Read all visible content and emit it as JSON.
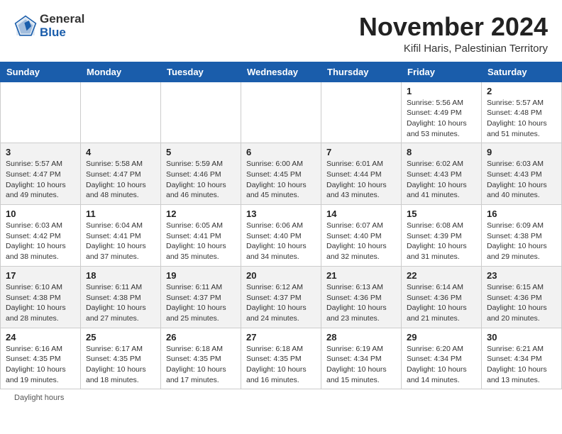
{
  "header": {
    "logo_general": "General",
    "logo_blue": "Blue",
    "month_title": "November 2024",
    "location": "Kifil Haris, Palestinian Territory"
  },
  "days_of_week": [
    "Sunday",
    "Monday",
    "Tuesday",
    "Wednesday",
    "Thursday",
    "Friday",
    "Saturday"
  ],
  "footer": {
    "daylight_hours": "Daylight hours"
  },
  "weeks": [
    [
      {
        "day": "",
        "info": ""
      },
      {
        "day": "",
        "info": ""
      },
      {
        "day": "",
        "info": ""
      },
      {
        "day": "",
        "info": ""
      },
      {
        "day": "",
        "info": ""
      },
      {
        "day": "1",
        "info": "Sunrise: 5:56 AM\nSunset: 4:49 PM\nDaylight: 10 hours and 53 minutes."
      },
      {
        "day": "2",
        "info": "Sunrise: 5:57 AM\nSunset: 4:48 PM\nDaylight: 10 hours and 51 minutes."
      }
    ],
    [
      {
        "day": "3",
        "info": "Sunrise: 5:57 AM\nSunset: 4:47 PM\nDaylight: 10 hours and 49 minutes."
      },
      {
        "day": "4",
        "info": "Sunrise: 5:58 AM\nSunset: 4:47 PM\nDaylight: 10 hours and 48 minutes."
      },
      {
        "day": "5",
        "info": "Sunrise: 5:59 AM\nSunset: 4:46 PM\nDaylight: 10 hours and 46 minutes."
      },
      {
        "day": "6",
        "info": "Sunrise: 6:00 AM\nSunset: 4:45 PM\nDaylight: 10 hours and 45 minutes."
      },
      {
        "day": "7",
        "info": "Sunrise: 6:01 AM\nSunset: 4:44 PM\nDaylight: 10 hours and 43 minutes."
      },
      {
        "day": "8",
        "info": "Sunrise: 6:02 AM\nSunset: 4:43 PM\nDaylight: 10 hours and 41 minutes."
      },
      {
        "day": "9",
        "info": "Sunrise: 6:03 AM\nSunset: 4:43 PM\nDaylight: 10 hours and 40 minutes."
      }
    ],
    [
      {
        "day": "10",
        "info": "Sunrise: 6:03 AM\nSunset: 4:42 PM\nDaylight: 10 hours and 38 minutes."
      },
      {
        "day": "11",
        "info": "Sunrise: 6:04 AM\nSunset: 4:41 PM\nDaylight: 10 hours and 37 minutes."
      },
      {
        "day": "12",
        "info": "Sunrise: 6:05 AM\nSunset: 4:41 PM\nDaylight: 10 hours and 35 minutes."
      },
      {
        "day": "13",
        "info": "Sunrise: 6:06 AM\nSunset: 4:40 PM\nDaylight: 10 hours and 34 minutes."
      },
      {
        "day": "14",
        "info": "Sunrise: 6:07 AM\nSunset: 4:40 PM\nDaylight: 10 hours and 32 minutes."
      },
      {
        "day": "15",
        "info": "Sunrise: 6:08 AM\nSunset: 4:39 PM\nDaylight: 10 hours and 31 minutes."
      },
      {
        "day": "16",
        "info": "Sunrise: 6:09 AM\nSunset: 4:38 PM\nDaylight: 10 hours and 29 minutes."
      }
    ],
    [
      {
        "day": "17",
        "info": "Sunrise: 6:10 AM\nSunset: 4:38 PM\nDaylight: 10 hours and 28 minutes."
      },
      {
        "day": "18",
        "info": "Sunrise: 6:11 AM\nSunset: 4:38 PM\nDaylight: 10 hours and 27 minutes."
      },
      {
        "day": "19",
        "info": "Sunrise: 6:11 AM\nSunset: 4:37 PM\nDaylight: 10 hours and 25 minutes."
      },
      {
        "day": "20",
        "info": "Sunrise: 6:12 AM\nSunset: 4:37 PM\nDaylight: 10 hours and 24 minutes."
      },
      {
        "day": "21",
        "info": "Sunrise: 6:13 AM\nSunset: 4:36 PM\nDaylight: 10 hours and 23 minutes."
      },
      {
        "day": "22",
        "info": "Sunrise: 6:14 AM\nSunset: 4:36 PM\nDaylight: 10 hours and 21 minutes."
      },
      {
        "day": "23",
        "info": "Sunrise: 6:15 AM\nSunset: 4:36 PM\nDaylight: 10 hours and 20 minutes."
      }
    ],
    [
      {
        "day": "24",
        "info": "Sunrise: 6:16 AM\nSunset: 4:35 PM\nDaylight: 10 hours and 19 minutes."
      },
      {
        "day": "25",
        "info": "Sunrise: 6:17 AM\nSunset: 4:35 PM\nDaylight: 10 hours and 18 minutes."
      },
      {
        "day": "26",
        "info": "Sunrise: 6:18 AM\nSunset: 4:35 PM\nDaylight: 10 hours and 17 minutes."
      },
      {
        "day": "27",
        "info": "Sunrise: 6:18 AM\nSunset: 4:35 PM\nDaylight: 10 hours and 16 minutes."
      },
      {
        "day": "28",
        "info": "Sunrise: 6:19 AM\nSunset: 4:34 PM\nDaylight: 10 hours and 15 minutes."
      },
      {
        "day": "29",
        "info": "Sunrise: 6:20 AM\nSunset: 4:34 PM\nDaylight: 10 hours and 14 minutes."
      },
      {
        "day": "30",
        "info": "Sunrise: 6:21 AM\nSunset: 4:34 PM\nDaylight: 10 hours and 13 minutes."
      }
    ]
  ]
}
